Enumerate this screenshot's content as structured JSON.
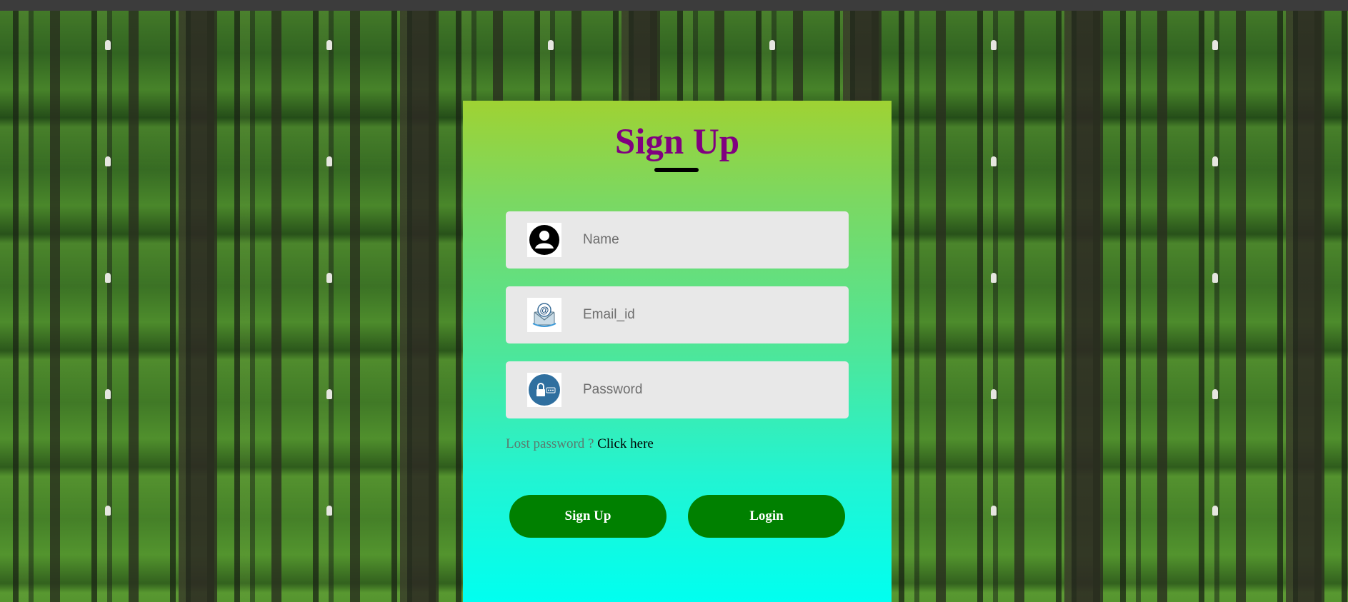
{
  "page": {
    "background": "forest-photo-tiled"
  },
  "form": {
    "title": "Sign Up",
    "title_color": "#800080",
    "fields": [
      {
        "icon": "user-icon",
        "placeholder": "Name"
      },
      {
        "icon": "email-icon",
        "placeholder": "Email_id"
      },
      {
        "icon": "lock-icon",
        "placeholder": "Password"
      }
    ],
    "lost_password": {
      "text": "Lost password ? ",
      "link_text": "Click here"
    },
    "buttons": {
      "signup_label": "Sign Up",
      "login_label": "Login",
      "color": "#008000"
    },
    "gradient": {
      "top": "#9fd233",
      "bottom": "#00fff0"
    }
  }
}
